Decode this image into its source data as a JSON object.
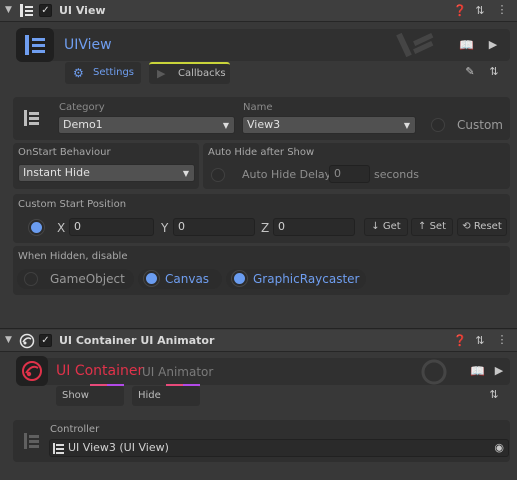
{
  "ui_view": {
    "header_title": "UI View",
    "checkbox_checked": "✓",
    "title": "UIView",
    "tabs": [
      {
        "label": "Settings"
      },
      {
        "label": "Callbacks"
      }
    ],
    "category": {
      "label": "Category",
      "value": "Demo1"
    },
    "name": {
      "label": "Name",
      "value": "View3"
    },
    "custom_label": "Custom",
    "on_start": {
      "label": "OnStart Behaviour",
      "value": "Instant Hide"
    },
    "auto_hide": {
      "label": "Auto Hide after Show",
      "delay_label": "Auto Hide Delay",
      "delay_value": "0",
      "unit": "seconds"
    },
    "custom_start": {
      "label": "Custom Start Position",
      "x_label": "X",
      "x_value": "0",
      "y_label": "Y",
      "y_value": "0",
      "z_label": "Z",
      "z_value": "0",
      "get_label": "Get",
      "set_label": "Set",
      "reset_label": "Reset"
    },
    "when_hidden": {
      "label": "When Hidden, disable",
      "options": [
        {
          "label": "GameObject",
          "checked": false
        },
        {
          "label": "Canvas",
          "checked": true
        },
        {
          "label": "GraphicRaycaster",
          "checked": true
        }
      ]
    }
  },
  "animator": {
    "header_title": "UI Container UI Animator",
    "checkbox_checked": "✓",
    "title": "UI Container",
    "subtitle": "UI Animator",
    "tabs": [
      {
        "label": "Show"
      },
      {
        "label": "Hide"
      }
    ],
    "controller": {
      "label": "Controller",
      "value": "UI View3 (UI View)"
    }
  },
  "colors": {
    "accent_blue": "#6f9ef0",
    "accent_red": "#e0324a",
    "accent_pink": "#e84a7a",
    "accent_purple": "#b24ae8",
    "callbacks_underline": "#c9d43a"
  }
}
